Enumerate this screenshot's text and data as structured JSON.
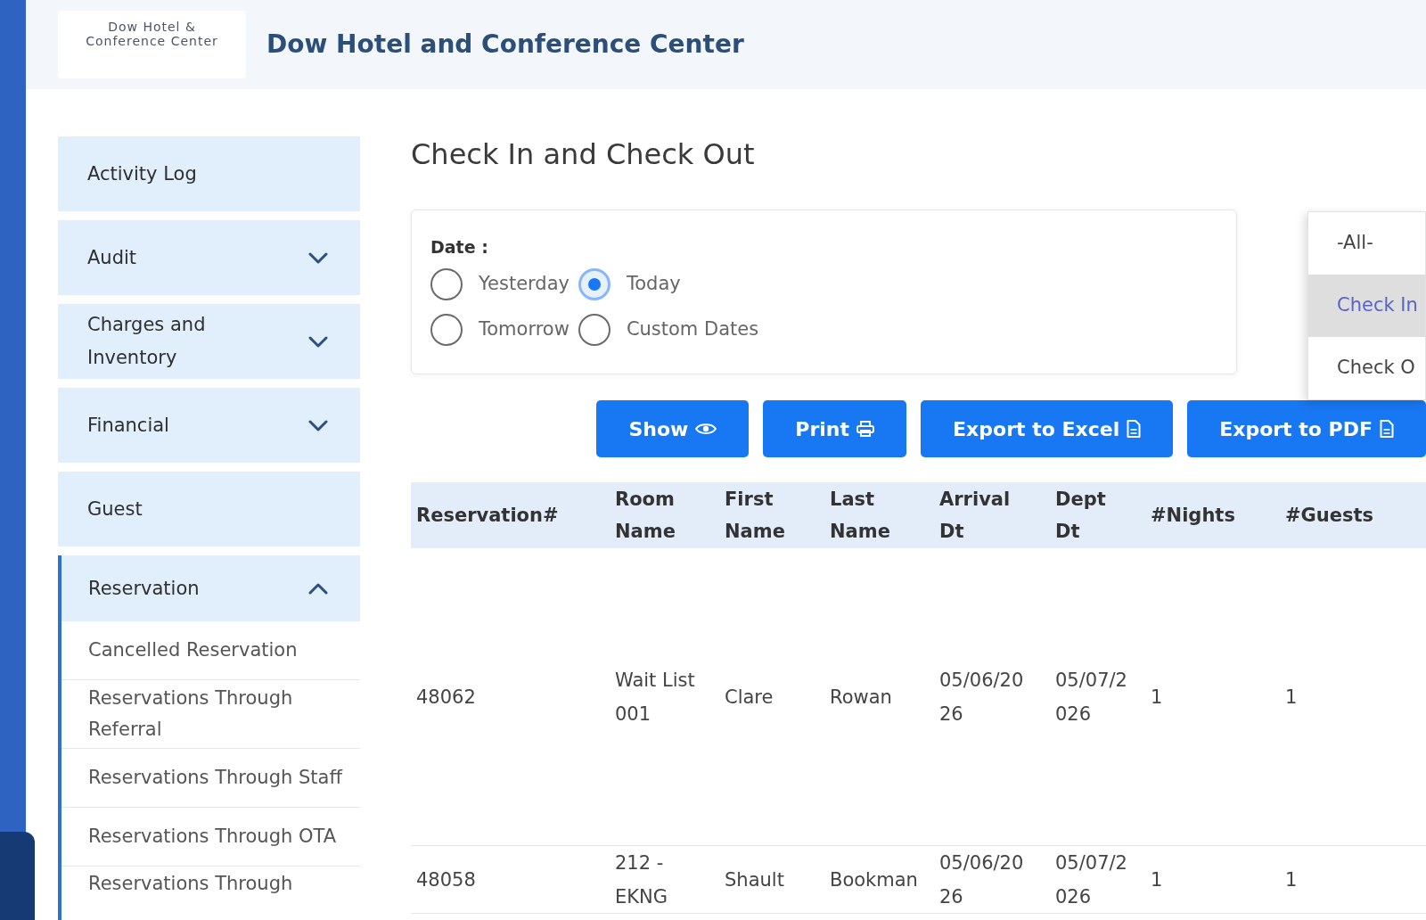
{
  "header": {
    "logo_lines": [
      "Dow Hotel &",
      "Conference Center"
    ],
    "title": "Dow Hotel and Conference Center"
  },
  "sidebar": {
    "items": [
      {
        "label": "Activity Log",
        "kind": "link"
      },
      {
        "label": "Audit",
        "kind": "group",
        "expanded": false
      },
      {
        "label": "Charges and Inventory",
        "kind": "group",
        "expanded": false
      },
      {
        "label": "Financial",
        "kind": "group",
        "expanded": false
      },
      {
        "label": "Guest",
        "kind": "link"
      },
      {
        "label": "Reservation",
        "kind": "group",
        "expanded": true,
        "children": [
          {
            "label": "Cancelled Reservation"
          },
          {
            "label": "Reservations Through Referral"
          },
          {
            "label": "Reservations Through Staff"
          },
          {
            "label": "Reservations Through OTA"
          },
          {
            "label": "Reservations Through"
          }
        ]
      }
    ]
  },
  "page_title": "Check In and Check Out",
  "date_filter": {
    "label": "Date :",
    "options": [
      {
        "label": "Yesterday",
        "selected": false
      },
      {
        "label": "Today",
        "selected": true
      },
      {
        "label": "Tomorrow",
        "selected": false
      },
      {
        "label": "Custom Dates",
        "selected": false
      }
    ]
  },
  "type_dropdown": {
    "options": [
      {
        "label": "-All-",
        "selected": false
      },
      {
        "label": "Check In",
        "selected": true
      },
      {
        "label": "Check O",
        "selected": false
      }
    ]
  },
  "buttons": [
    "Show",
    "Print",
    "Export to Excel",
    "Export to PDF"
  ],
  "table": {
    "columns": [
      "Reservation#",
      "Room Name",
      "First Name",
      "Last Name",
      "Arrival Dt",
      "Dept Dt",
      "#Nights",
      "#Guests"
    ],
    "rows": [
      {
        "cells": [
          "48062",
          "Wait List 001",
          "Clare",
          "Rowan",
          "05/06/2026",
          "05/07/2026",
          "1",
          "1"
        ]
      },
      {
        "cells": [
          "48058",
          "212 - EKNG",
          "Shault",
          "Bookman",
          "05/06/2026",
          "05/07/2026",
          "1",
          "1"
        ]
      }
    ]
  }
}
